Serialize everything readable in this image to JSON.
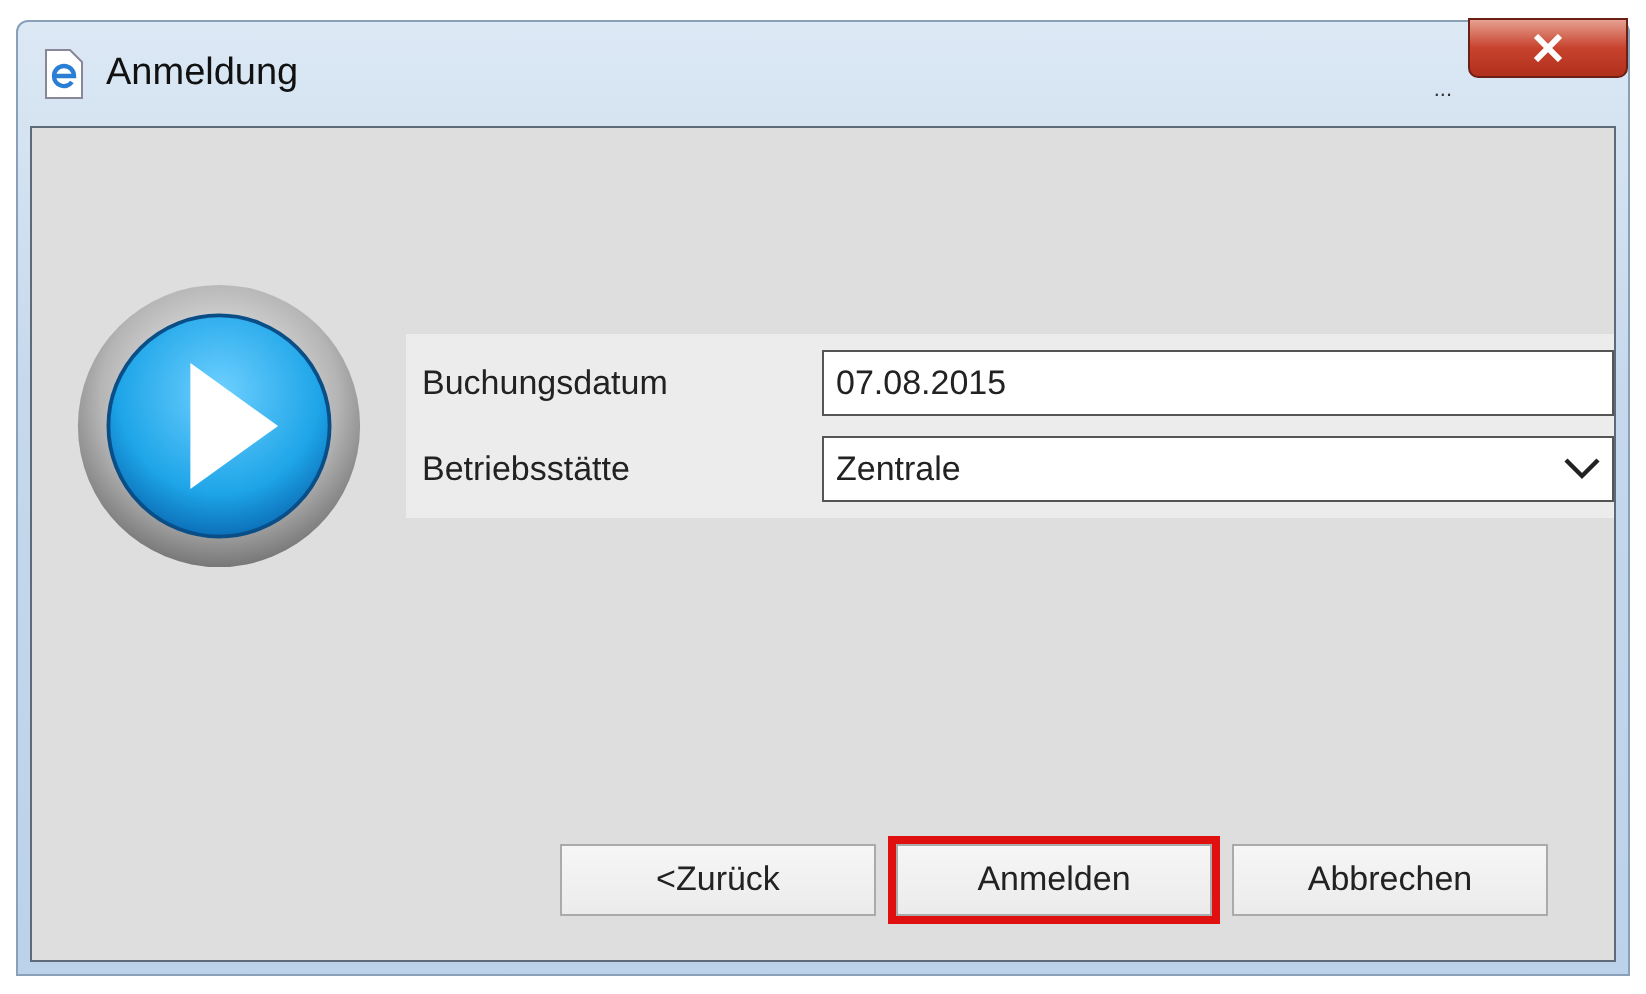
{
  "window": {
    "title": "Anmeldung",
    "title_extra": "..."
  },
  "form": {
    "fields": [
      {
        "kind": "text",
        "label": "Buchungsdatum",
        "value": "07.08.2015"
      },
      {
        "kind": "select",
        "label": "Betriebsstätte",
        "value": "Zentrale"
      }
    ]
  },
  "buttons": [
    {
      "label": "<Zurück",
      "highlighted": false
    },
    {
      "label": "Anmelden",
      "highlighted": true
    },
    {
      "label": "Abbrechen",
      "highlighted": false
    }
  ]
}
